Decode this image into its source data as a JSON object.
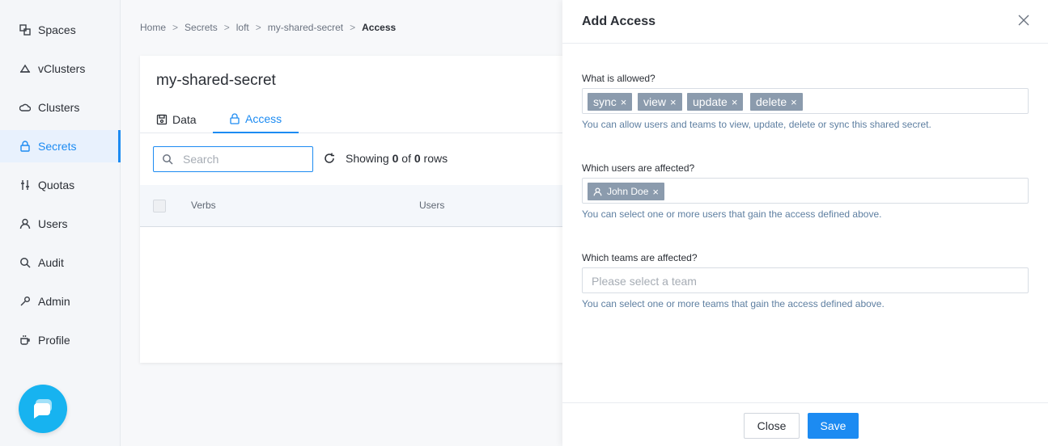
{
  "sidebar": {
    "items": [
      {
        "label": "Spaces",
        "icon": "spaces-icon"
      },
      {
        "label": "vClusters",
        "icon": "vclusters-icon"
      },
      {
        "label": "Clusters",
        "icon": "clusters-icon"
      },
      {
        "label": "Secrets",
        "icon": "lock-icon",
        "active": true
      },
      {
        "label": "Quotas",
        "icon": "sliders-icon"
      },
      {
        "label": "Users",
        "icon": "user-icon"
      },
      {
        "label": "Audit",
        "icon": "search-icon"
      },
      {
        "label": "Admin",
        "icon": "wrench-icon"
      },
      {
        "label": "Profile",
        "icon": "coffee-icon"
      }
    ]
  },
  "breadcrumb": {
    "items": [
      "Home",
      "Secrets",
      "loft",
      "my-shared-secret"
    ],
    "separator": ">",
    "current": "Access"
  },
  "card": {
    "title": "my-shared-secret",
    "tabs": [
      {
        "label": "Data",
        "icon": "save-icon"
      },
      {
        "label": "Access",
        "icon": "lock-icon",
        "active": true
      }
    ],
    "search_placeholder": "Search",
    "showing_prefix": "Showing",
    "showing_count": "0",
    "showing_of": "of",
    "showing_total": "0",
    "showing_suffix": "rows",
    "columns": [
      "Verbs",
      "Users"
    ]
  },
  "panel": {
    "title": "Add Access",
    "allowed_label": "What is allowed?",
    "verbs": [
      "sync",
      "view",
      "update",
      "delete"
    ],
    "allowed_help": "You can allow users and teams to view, update, delete or sync this shared secret.",
    "users_label": "Which users are affected?",
    "users": [
      "John Doe"
    ],
    "users_help": "You can select one or more users that gain the access defined above.",
    "teams_label": "Which teams are affected?",
    "teams_placeholder": "Please select a team",
    "teams_help": "You can select one or more teams that gain the access defined above.",
    "close_label": "Close",
    "save_label": "Save"
  },
  "colors": {
    "accent": "#1c8bf2",
    "tag_bg": "#8b9bad",
    "help_text": "#5e7fa1",
    "chat_button": "#17b3f0"
  }
}
